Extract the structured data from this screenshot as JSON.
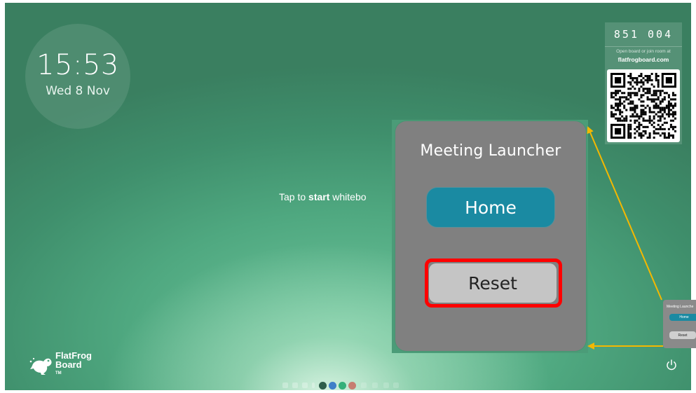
{
  "clock": {
    "time": "15:53",
    "date": "Wed 8 Nov"
  },
  "hint": {
    "prefix": "Tap to ",
    "emphasis": "start",
    "suffix": " whitebo"
  },
  "room": {
    "code": "851 004",
    "note": "Open board or join room at",
    "site": "flatfrogboard.com"
  },
  "brand": {
    "line1": "FlatFrog",
    "line2": "Board",
    "tm": "TM"
  },
  "launcher": {
    "title": "Meeting Launcher",
    "home_label": "Home",
    "reset_label": "Reset"
  },
  "mini_launcher": {
    "title": "Meeting Launche",
    "home_label": "Home",
    "reset_label": "Reset"
  },
  "colors": {
    "background_green": "#4fa880",
    "launcher_gray": "#808080",
    "home_teal": "#1a8aa2",
    "reset_gray": "#c5c5c5",
    "highlight_red": "#ff0000",
    "arrow_yellow": "#f5b800"
  },
  "icons": {
    "power": "power-icon",
    "qr": "qr-code-icon",
    "logo": "frog-logo-icon"
  }
}
